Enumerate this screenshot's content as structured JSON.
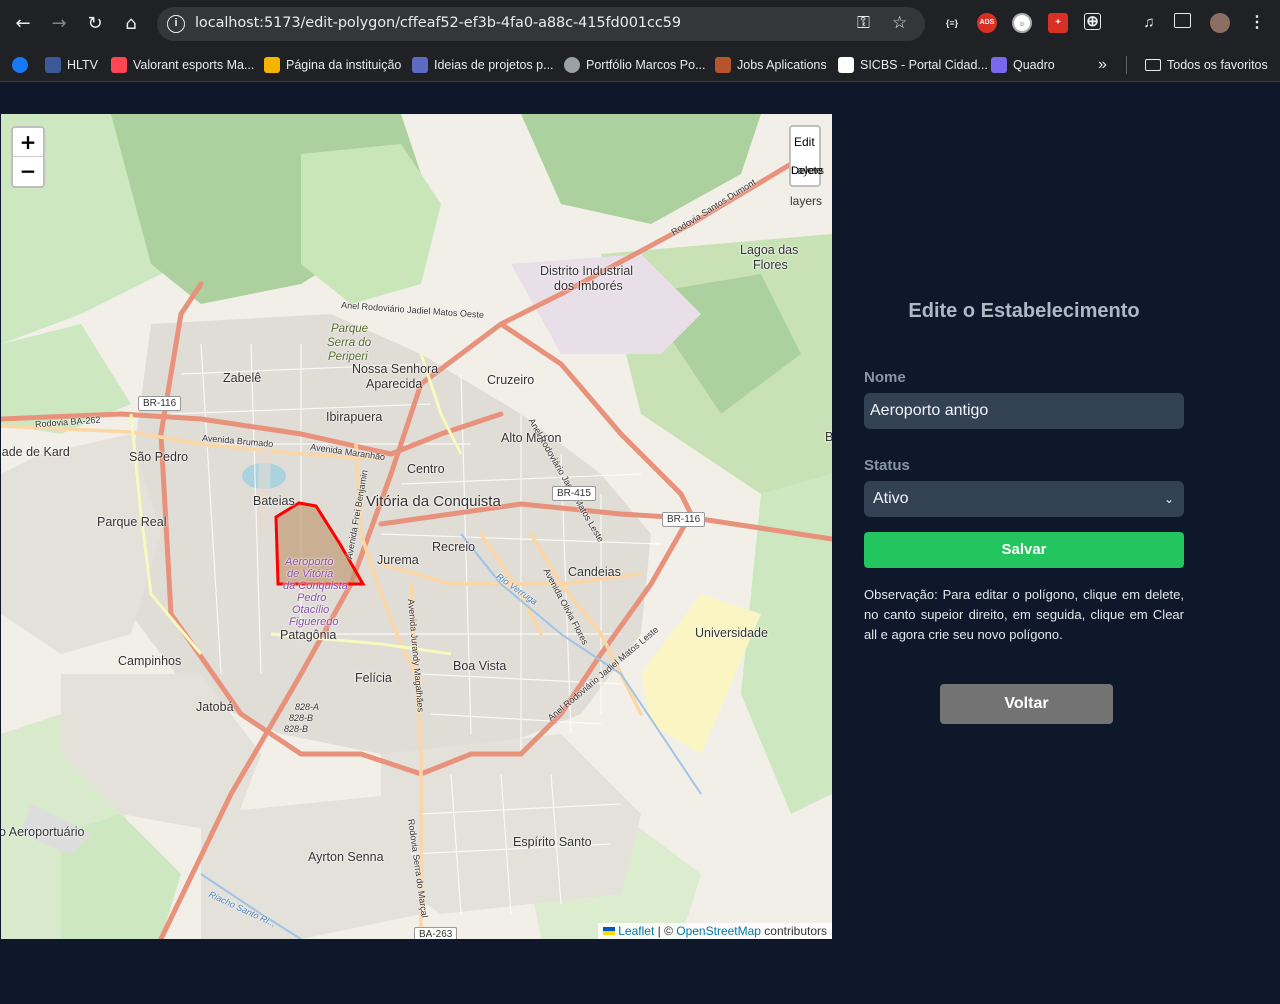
{
  "browser": {
    "url": "localhost:5173/edit-polygon/cffeaf52-ef3b-4fa0-a88c-415fd001cc59",
    "bookmarks": [
      {
        "label": "HLTV",
        "color": "#3b5998"
      },
      {
        "label": "Valorant esports Ma...",
        "color": "#ff4655"
      },
      {
        "label": "Página da instituição",
        "color": "#f4b400"
      },
      {
        "label": "Ideias de projetos p...",
        "color": "#5c6bc0"
      },
      {
        "label": "Portfólio Marcos Po...",
        "color": "#9aa0a6"
      },
      {
        "label": "Jobs Aplications",
        "color": "#b5542d"
      },
      {
        "label": "SICBS - Portal Cidad...",
        "color": "#ffffff"
      },
      {
        "label": "Quadro",
        "color": "#7b68ee"
      }
    ],
    "all_bookmarks": "Todos os favoritos"
  },
  "map": {
    "zoom_in": "+",
    "zoom_out": "−",
    "edit_label": "Edit",
    "delete_label": "Delete",
    "layers_label": "Layers",
    "layers_text": "layers",
    "attribution": {
      "leaflet": "Leaflet",
      "sep": " | © ",
      "osm": "OpenStreetMap",
      "contrib": " contributors"
    },
    "labels": {
      "distrito": "Distrito Industrial",
      "imbores": "dos Imborés",
      "lagoa1": "Lagoa das",
      "lagoa2": "Flores",
      "parque": "Parque",
      "serra": "Serra do",
      "periperi": "Periperi",
      "nossa1": "Nossa Senhora",
      "nossa2": "Aparecida",
      "zabele": "Zabelê",
      "cruzeiro": "Cruzeiro",
      "ibirapuera": "Ibirapuera",
      "altomaron": "Alto Maron",
      "saopedro": "São Pedro",
      "lade": "lade de Kard",
      "centro": "Centro",
      "vitoria": "Vitória da Conquista",
      "bateias": "Bateias",
      "parquereal": "Parque Real",
      "recreio": "Recreio",
      "jurema": "Jurema",
      "candeias": "Candeias",
      "aero1": "Aeroporto",
      "aero2": "de Vitória",
      "aero3": "da Conquista",
      "pedro1": "Pedro",
      "pedro2": "Otacílio",
      "pedro3": "Figueredo",
      "patagonia": "Patagônia",
      "universidade": "Universidade",
      "campinhos": "Campinhos",
      "boavista": "Boa Vista",
      "felicia": "Felícia",
      "jatoba": "Jatobá",
      "aeroportuario": "o Aeroportuário",
      "ayrton": "Ayrton Senna",
      "espirito": "Espírito Santo",
      "b": "B",
      "santosdumont": "Rodovia Santos Dumont",
      "anelmatos": "Anel Rodoviário Jadiel Matos Oeste",
      "anelleste": "Anel Rodoviário Jadiel Matos Leste",
      "anelleste2": "Anel Rodoviário Jadiel Matos Leste",
      "brumado": "Avenida Brumado",
      "maranhao": "Avenida Maranhão",
      "rodoviaba262": "Rodovia BA-262",
      "freibenjamin": "Avenida Frei Benjamin",
      "olivia": "Avenida Olivia Flores",
      "jurandy": "Avenida Jurandy Magalhães",
      "serramarcal": "Rodovia Serra do Marçal",
      "verruga": "Rio Verruga",
      "rachosanto": "Riacho Santo Ri...",
      "b828a": "828-A",
      "b828b": "828-B",
      "b828b2": "828-B"
    },
    "shields": {
      "br116a": "BR-116",
      "br415": "BR-415",
      "br116b": "BR-116",
      "ba263": "BA-263"
    }
  },
  "form": {
    "title": "Edite o Estabelecimento",
    "name_label": "Nome",
    "name_value": "Aeroporto antigo",
    "status_label": "Status",
    "status_value": "Ativo",
    "save": "Salvar",
    "note": "Observação: Para editar o polígono, clique em delete, no canto supeior direito, em seguida, clique em Clear all e agora crie seu novo polígono.",
    "back": "Voltar"
  },
  "colors": {
    "page_bg": "#0f172a",
    "save_bg": "#22c55e",
    "back_bg": "#737373",
    "polygon_stroke": "#ff0000"
  }
}
